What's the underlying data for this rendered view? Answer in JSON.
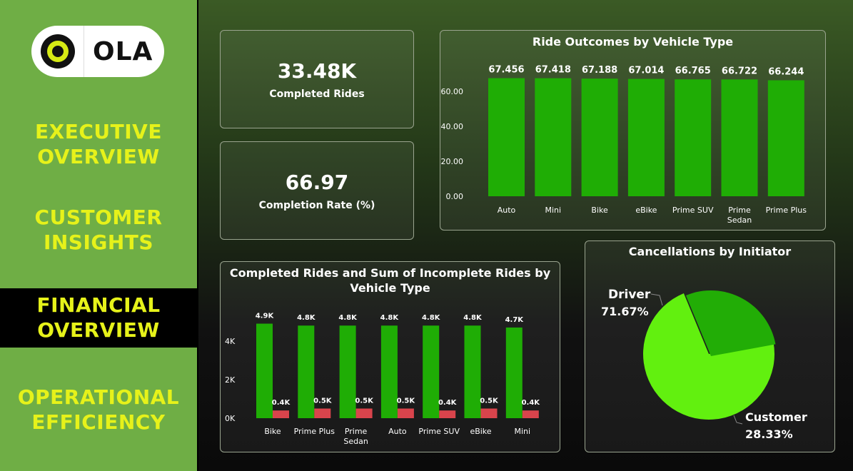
{
  "brand": {
    "name": "OLA"
  },
  "nav": {
    "executive": "EXECUTIVE\nOVERVIEW",
    "customer": "CUSTOMER\nINSIGHTS",
    "financial": "FINANCIAL\nOVERVIEW",
    "operational": "OPERATIONAL\nEFFICIENCY"
  },
  "kpis": {
    "completed_rides_value": "33.48K",
    "completed_rides_label": "Completed Rides",
    "completion_rate_value": "66.97",
    "completion_rate_label": "Completion Rate (%)"
  },
  "colors": {
    "green_bar": "#1fad05",
    "red_bar": "#d9444c",
    "pie_driver": "#62f00f",
    "pie_customer": "#22ad06",
    "nav_text": "#e6f21a"
  },
  "chart_data": [
    {
      "type": "bar",
      "title": "Ride Outcomes by Vehicle Type",
      "categories": [
        "Auto",
        "Mini",
        "Bike",
        "eBike",
        "Prime SUV",
        "Prime Sedan",
        "Prime Plus"
      ],
      "values": [
        67.456,
        67.418,
        67.188,
        67.014,
        66.765,
        66.722,
        66.244
      ],
      "data_labels": [
        "67.456",
        "67.418",
        "67.188",
        "67.014",
        "66.765",
        "66.722",
        "66.244"
      ],
      "yticks": [
        "0.00",
        "20.00",
        "40.00",
        "60.00"
      ],
      "ylim": [
        0,
        75
      ]
    },
    {
      "type": "bar",
      "title": "Completed Rides and Sum of Incomplete Rides by Vehicle Type",
      "categories": [
        "Bike",
        "Prime Plus",
        "Prime Sedan",
        "Auto",
        "Prime SUV",
        "eBike",
        "Mini"
      ],
      "series": [
        {
          "values": [
            4900,
            4800,
            4800,
            4800,
            4800,
            4800,
            4700
          ],
          "labels": [
            "4.9K",
            "4.8K",
            "4.8K",
            "4.8K",
            "4.8K",
            "4.8K",
            "4.7K"
          ]
        },
        {
          "values": [
            400,
            500,
            500,
            500,
            400,
            500,
            400
          ],
          "labels": [
            "0.4K",
            "0.5K",
            "0.5K",
            "0.5K",
            "0.4K",
            "0.5K",
            "0.4K"
          ]
        }
      ],
      "yticks": [
        "0K",
        "2K",
        "4K"
      ],
      "ylim": [
        0,
        5400
      ]
    },
    {
      "type": "pie",
      "title": "Cancellations by Initiator",
      "slices": [
        {
          "name": "Driver",
          "value": 71.67,
          "label": "71.67%"
        },
        {
          "name": "Customer",
          "value": 28.33,
          "label": "28.33%"
        }
      ]
    }
  ]
}
